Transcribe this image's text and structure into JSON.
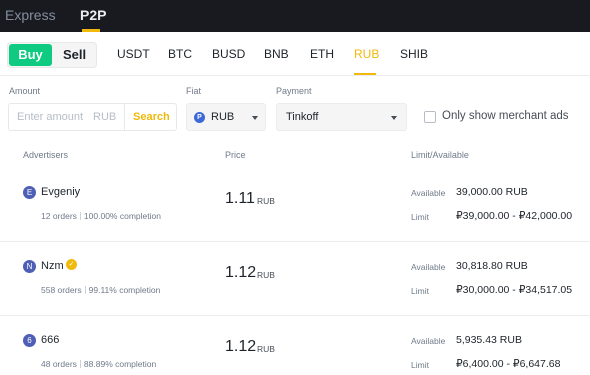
{
  "top_tabs": {
    "express": "Express",
    "p2p": "P2P"
  },
  "trade_toggle": {
    "buy": "Buy",
    "sell": "Sell"
  },
  "assets": [
    "USDT",
    "BTC",
    "BUSD",
    "BNB",
    "ETH",
    "RUB",
    "SHIB"
  ],
  "active_asset": "RUB",
  "filters": {
    "amount_label": "Amount",
    "amount_placeholder": "Enter amount",
    "amount_unit": "RUB",
    "search_label": "Search",
    "fiat_label": "Fiat",
    "fiat_value": "RUB",
    "fiat_icon": "P",
    "payment_label": "Payment",
    "payment_value": "Tinkoff",
    "merchant_only_label": "Only show merchant ads"
  },
  "table_headers": {
    "advertisers": "Advertisers",
    "price": "Price",
    "limit": "Limit/Available"
  },
  "ads": [
    {
      "initial": "E",
      "name": "Evgeniy",
      "verified": false,
      "orders": "12 orders",
      "completion": "100.00% completion",
      "price": "1.11",
      "currency": "RUB",
      "available_label": "Available",
      "available": "39,000.00 RUB",
      "limit_label": "Limit",
      "limit": "₽39,000.00 - ₽42,000.00"
    },
    {
      "initial": "N",
      "name": "Nzm",
      "verified": true,
      "orders": "558 orders",
      "completion": "99.11% completion",
      "price": "1.12",
      "currency": "RUB",
      "available_label": "Available",
      "available": "30,818.80 RUB",
      "limit_label": "Limit",
      "limit": "₽30,000.00 - ₽34,517.05"
    },
    {
      "initial": "6",
      "name": "666",
      "verified": false,
      "orders": "48 orders",
      "completion": "88.89% completion",
      "price": "1.12",
      "currency": "RUB",
      "available_label": "Available",
      "available": "5,935.43 RUB",
      "limit_label": "Limit",
      "limit": "₽6,400.00 - ₽6,647.68"
    }
  ],
  "colors": {
    "accent": "#f0b90b",
    "buy": "#0ecb81",
    "topbar": "#181a20"
  }
}
